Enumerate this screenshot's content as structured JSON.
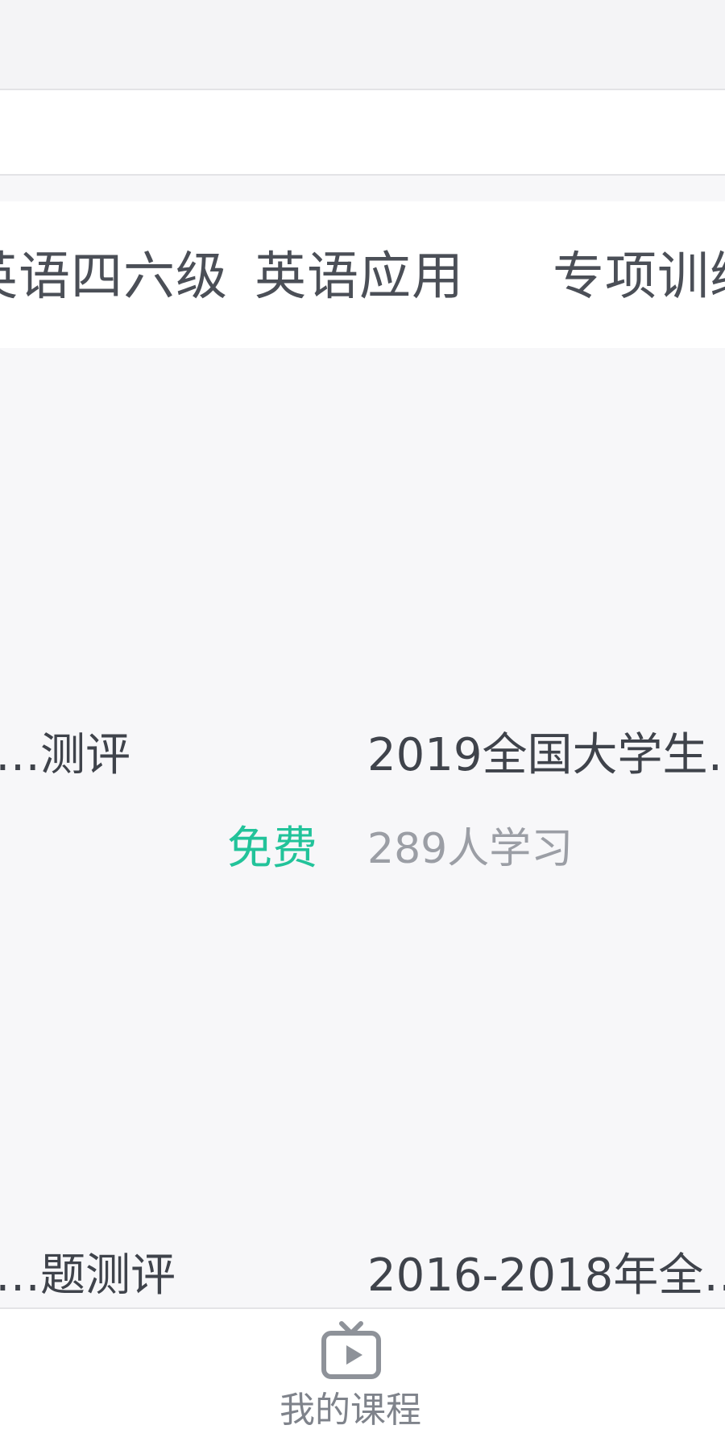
{
  "tabs": {
    "items": [
      {
        "label": "英语四六级"
      },
      {
        "label": "英语应用"
      },
      {
        "label": "专项训练"
      }
    ]
  },
  "courses": {
    "left": [
      {
        "title": "…测评"
      },
      {
        "title": "…题测评"
      }
    ],
    "right": [
      {
        "title": "2019全国大学生…",
        "learners": "289人学习"
      },
      {
        "title": "2016-2018年全…"
      }
    ],
    "free_label": "免费"
  },
  "bottom_nav": {
    "my_courses": "我的课程",
    "my_courses_icon": "tv-play-icon"
  },
  "colors": {
    "accent": "#22c39a",
    "muted_text": "#9b9ea5",
    "primary_text": "#3f434b"
  }
}
